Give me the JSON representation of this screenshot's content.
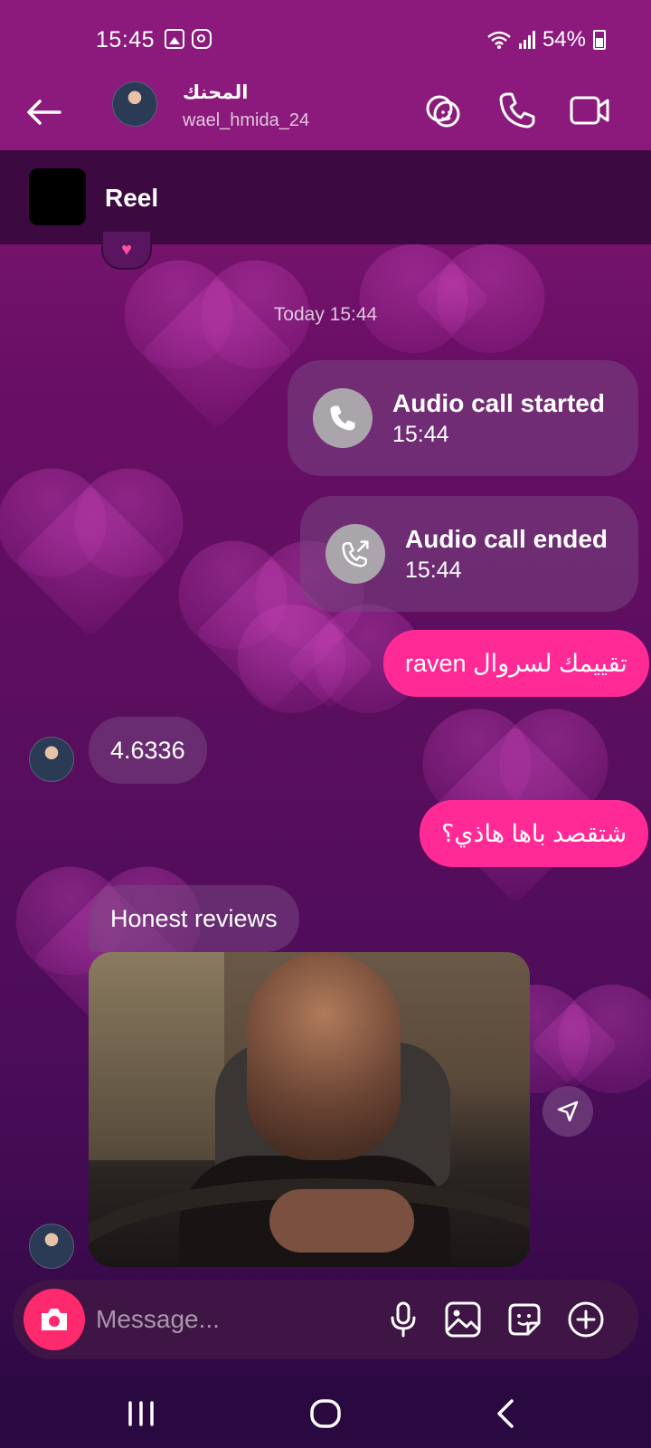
{
  "status_bar": {
    "time": "15:45",
    "battery": "54%",
    "left_icons": [
      "gallery-icon",
      "instagram-icon"
    ],
    "right_icons": [
      "wifi-icon",
      "signal-icon",
      "battery-icon"
    ]
  },
  "header": {
    "name": "المحنك",
    "username": "wael_hmida_24",
    "actions": [
      "effects-icon",
      "phone-icon",
      "video-icon"
    ]
  },
  "reel_banner": {
    "label": "Reel"
  },
  "reaction": "♥",
  "messages": {
    "date_separator": "Today 15:44",
    "call_started": {
      "title": "Audio call started",
      "time": "15:44"
    },
    "call_ended": {
      "title": "Audio call ended",
      "time": "15:44"
    },
    "sent_1": "تقييمك لسروال raven",
    "received_1": "4.6336",
    "sent_2": "شتقصد باها هاذي؟",
    "received_2": "Honest reviews"
  },
  "composer": {
    "placeholder": "Message..."
  },
  "colors": {
    "header_bg": "#8b1a7c",
    "sent_bubble": "#ff2a95",
    "camera_button": "#ff2a6e"
  }
}
